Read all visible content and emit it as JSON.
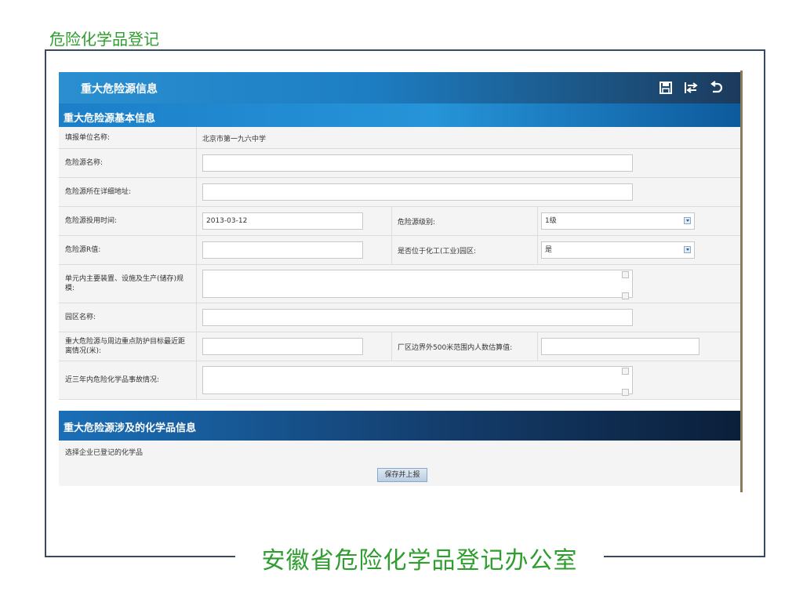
{
  "page": {
    "title": "危险化学品登记",
    "footer": "安徽省危险化学品登记办公室"
  },
  "panel": {
    "title": "重大危险源信息",
    "toolbar_icons": [
      "save-icon",
      "swap-icon",
      "back-icon"
    ],
    "section_basic": "重大危险源基本信息",
    "section_chem": "重大危险源涉及的化学品信息"
  },
  "form": {
    "unit_name_label": "填报单位名称:",
    "unit_name_value": "北京市第一九六中学",
    "source_name_label": "危险源名称:",
    "source_name_value": "",
    "address_label": "危险源所在详细地址:",
    "address_value": "",
    "start_time_label": "危险源投用时间:",
    "start_time_value": "2013-03-12",
    "level_label": "危险源级别:",
    "level_value": "1级",
    "r_value_label": "危险源R值:",
    "r_value_value": "",
    "in_park_label": "是否位于化工(工业)园区:",
    "in_park_value": "是",
    "equipment_label": "单元内主要装置、设施及生产(储存)规模:",
    "equipment_value": "",
    "park_name_label": "园区名称:",
    "park_name_value": "",
    "distance_label": "重大危险源与周边重点防护目标最近距离情况(米):",
    "distance_value": "",
    "population_label": "厂区边界外500米范围内人数估算值:",
    "population_value": "",
    "accidents_label": "近三年内危险化学品事故情况:",
    "accidents_value": ""
  },
  "chem": {
    "select_label": "选择企业已登记的化学品",
    "save_button": "保存并上报"
  }
}
